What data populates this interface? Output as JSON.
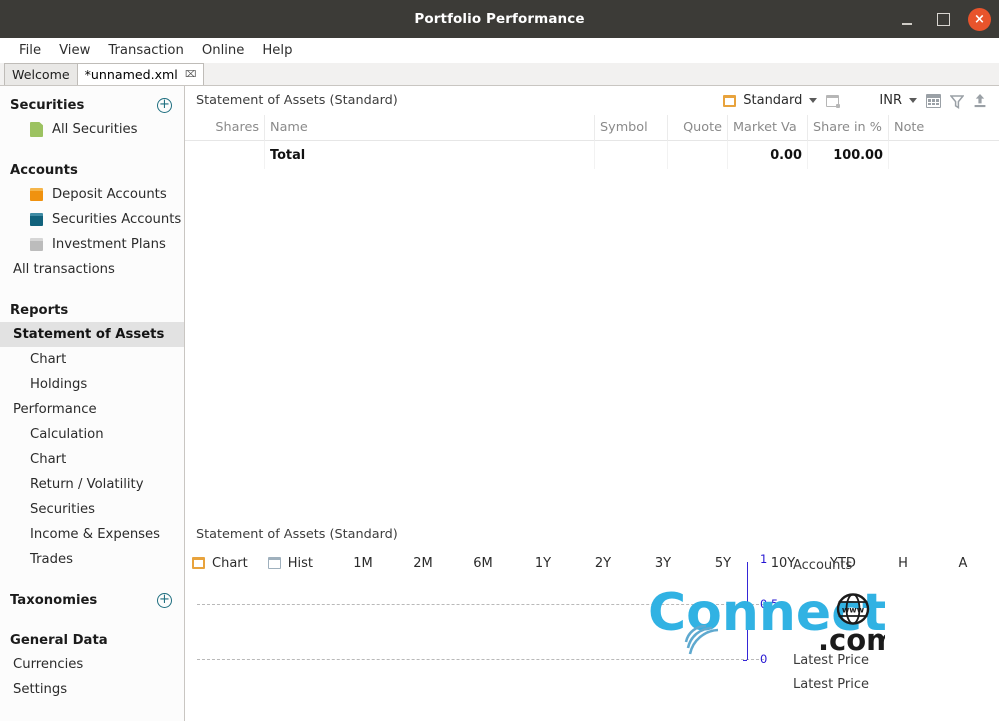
{
  "window": {
    "title": "Portfolio Performance",
    "controls": [
      {
        "name": "minimize",
        "glyph": ""
      },
      {
        "name": "maximize",
        "glyph": ""
      },
      {
        "name": "close",
        "glyph": "×"
      }
    ]
  },
  "menubar": {
    "items": [
      {
        "label": "File"
      },
      {
        "label": "View"
      },
      {
        "label": "Transaction"
      },
      {
        "label": "Online"
      },
      {
        "label": "Help"
      }
    ]
  },
  "tabs": [
    {
      "label": "Welcome",
      "active": false,
      "closable": false
    },
    {
      "label": "*unnamed.xml",
      "active": true,
      "closable": true,
      "close_glyph": "⌧"
    }
  ],
  "sidebar": {
    "sections": [
      {
        "title": "Securities",
        "add_icon": "plus-circle-icon",
        "items": [
          {
            "label": "All Securities",
            "icon": "document-icon",
            "icon_class": "ico-doc",
            "indent": 1,
            "selected": false
          }
        ]
      },
      {
        "title": "Accounts",
        "add_icon": null,
        "items": [
          {
            "label": "Deposit Accounts",
            "icon": "orange-square-icon",
            "icon_class": "ico-sq-orange",
            "indent": 1,
            "selected": false
          },
          {
            "label": "Securities Accounts",
            "icon": "teal-square-icon",
            "icon_class": "ico-sq-teal",
            "indent": 1,
            "selected": false
          },
          {
            "label": "Investment Plans",
            "icon": "gray-square-icon",
            "icon_class": "ico-sq-gray",
            "indent": 1,
            "selected": false
          },
          {
            "label": "All transactions",
            "icon": null,
            "icon_class": "",
            "indent": 0,
            "selected": false
          }
        ]
      },
      {
        "title": "Reports",
        "add_icon": null,
        "items": [
          {
            "label": "Statement of Assets",
            "icon": null,
            "icon_class": "",
            "indent": 0,
            "selected": true
          },
          {
            "label": "Chart",
            "icon": null,
            "icon_class": "",
            "indent": 1,
            "selected": false
          },
          {
            "label": "Holdings",
            "icon": null,
            "icon_class": "",
            "indent": 1,
            "selected": false
          },
          {
            "label": "Performance",
            "icon": null,
            "icon_class": "",
            "indent": 0,
            "selected": false
          },
          {
            "label": "Calculation",
            "icon": null,
            "icon_class": "",
            "indent": 1,
            "selected": false
          },
          {
            "label": "Chart",
            "icon": null,
            "icon_class": "",
            "indent": 1,
            "selected": false
          },
          {
            "label": "Return / Volatility",
            "icon": null,
            "icon_class": "",
            "indent": 1,
            "selected": false
          },
          {
            "label": "Securities",
            "icon": null,
            "icon_class": "",
            "indent": 1,
            "selected": false
          },
          {
            "label": "Income & Expenses",
            "icon": null,
            "icon_class": "",
            "indent": 1,
            "selected": false
          },
          {
            "label": "Trades",
            "icon": null,
            "icon_class": "",
            "indent": 1,
            "selected": false
          }
        ]
      },
      {
        "title": "Taxonomies",
        "add_icon": "plus-circle-icon",
        "items": []
      },
      {
        "title": "General Data",
        "add_icon": null,
        "items": [
          {
            "label": "Currencies",
            "icon": null,
            "icon_class": "",
            "indent": 0,
            "selected": false
          },
          {
            "label": "Settings",
            "icon": null,
            "icon_class": "",
            "indent": 0,
            "selected": false
          }
        ]
      }
    ]
  },
  "upper_pane": {
    "title": "Statement of Assets (Standard)",
    "toolbar": {
      "config_icon": "orange-box-icon",
      "config_label": "Standard",
      "config_chevron": "chevron-down-icon",
      "new_config_icon": "new-config-icon",
      "currency_label": "INR",
      "currency_chevron": "chevron-down-icon",
      "calendar_icon": "calendar-icon",
      "filter_icon": "filter-icon",
      "export_icon": "export-icon"
    },
    "table": {
      "columns": [
        {
          "label": "Shares",
          "key": "shares"
        },
        {
          "label": "Name",
          "key": "name"
        },
        {
          "label": "Symbol",
          "key": "symbol"
        },
        {
          "label": "Quote",
          "key": "quote"
        },
        {
          "label": "Market Va",
          "key": "market_value"
        },
        {
          "label": "Share in %",
          "key": "share_pct"
        },
        {
          "label": "Note",
          "key": "note"
        }
      ],
      "rows": [
        {
          "shares": "",
          "name": "Total",
          "symbol": "",
          "quote": "",
          "market_value": "0.00",
          "share_pct": "100.00",
          "note": ""
        }
      ]
    }
  },
  "lower_pane": {
    "title": "Statement of Assets (Standard)",
    "tabs": [
      {
        "label": "Chart",
        "icon": "orange-box-icon",
        "type": "icon"
      },
      {
        "label": "Hist",
        "icon": "gray-box-icon",
        "type": "icon"
      },
      {
        "label": "1M",
        "icon": null,
        "type": "period"
      },
      {
        "label": "2M",
        "icon": null,
        "type": "period"
      },
      {
        "label": "6M",
        "icon": null,
        "type": "period"
      },
      {
        "label": "1Y",
        "icon": null,
        "type": "period"
      },
      {
        "label": "2Y",
        "icon": null,
        "type": "period"
      },
      {
        "label": "3Y",
        "icon": null,
        "type": "period"
      },
      {
        "label": "5Y",
        "icon": null,
        "type": "period"
      },
      {
        "label": "10Y",
        "icon": null,
        "type": "period"
      },
      {
        "label": "YTD",
        "icon": null,
        "type": "period"
      },
      {
        "label": "H",
        "icon": null,
        "type": "period"
      },
      {
        "label": "A",
        "icon": null,
        "type": "period"
      }
    ]
  },
  "chart_data": {
    "type": "line",
    "title": "Statement of Assets (Standard)",
    "xlabel": "",
    "ylabel": "",
    "ylim": [
      0,
      1
    ],
    "yticks": [
      "0",
      "0.5",
      "1"
    ],
    "grid": true,
    "grid_lines_at": [
      0,
      0.5
    ],
    "legend_position": "right",
    "series": [
      {
        "name": "Accounts",
        "values": []
      },
      {
        "name": "Latest Price",
        "values": []
      },
      {
        "name": "Latest Price",
        "values": []
      }
    ],
    "axis_color": "#2414d2",
    "gridline_color": "#b9b9b9"
  },
  "watermark": {
    "text_main": "Connect",
    "text_suffix": ".com",
    "www_label": "www",
    "color": "#31b2e3"
  },
  "colors": {
    "titlebar_bg": "#3c3b37",
    "close_btn": "#e8542c",
    "accent_orange": "#f0920f",
    "accent_teal": "#11627c",
    "accent_green": "#9cc261",
    "selection_bg": "#e2e2e2"
  }
}
